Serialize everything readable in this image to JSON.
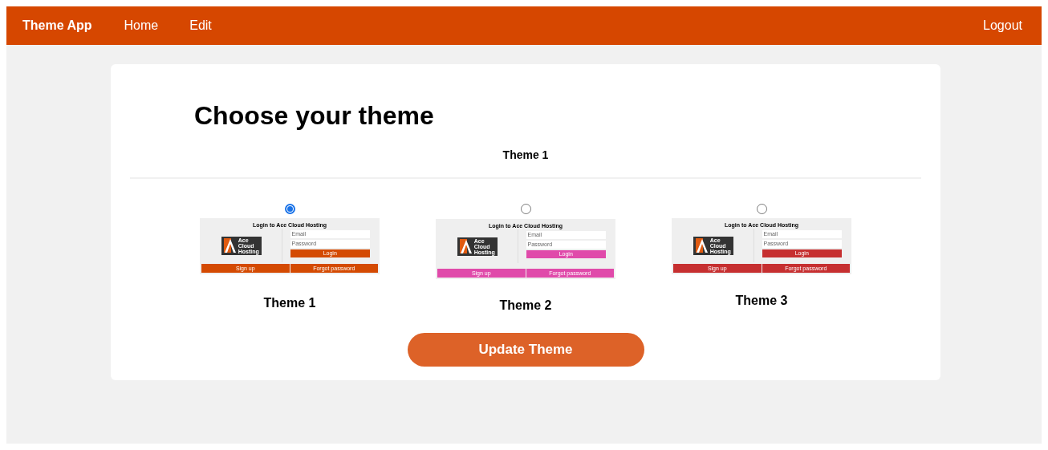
{
  "navbar": {
    "brand": "Theme App",
    "links": [
      {
        "label": "Home"
      },
      {
        "label": "Edit"
      }
    ],
    "logout": "Logout"
  },
  "heading": "Choose your theme",
  "current_theme": "Theme 1",
  "themes": [
    {
      "name": "Theme 1",
      "selected": true,
      "color": "#d44a02",
      "preview": {
        "title": "Login to Ace Cloud Hosting",
        "logo_text": [
          "Ace",
          "Cloud",
          "Hosting"
        ],
        "email": "Email",
        "password": "Password",
        "login": "Login",
        "sign_up": "Sign up",
        "forgot": "Forgot password"
      }
    },
    {
      "name": "Theme 2",
      "selected": false,
      "color": "#e04aaa",
      "preview": {
        "title": "Login to Ace Cloud Hosting",
        "logo_text": [
          "Ace",
          "Cloud",
          "Hosting"
        ],
        "email": "Email",
        "password": "Password",
        "login": "Login",
        "sign_up": "Sign up",
        "forgot": "Forgot password"
      }
    },
    {
      "name": "Theme 3",
      "selected": false,
      "color": "#c62f30",
      "preview": {
        "title": "Login to Ace Cloud Hosting",
        "logo_text": [
          "Ace",
          "Cloud",
          "Hosting"
        ],
        "email": "Email",
        "password": "Password",
        "login": "Login",
        "sign_up": "Sign up",
        "forgot": "Forgot password"
      }
    }
  ],
  "update_button": "Update Theme"
}
